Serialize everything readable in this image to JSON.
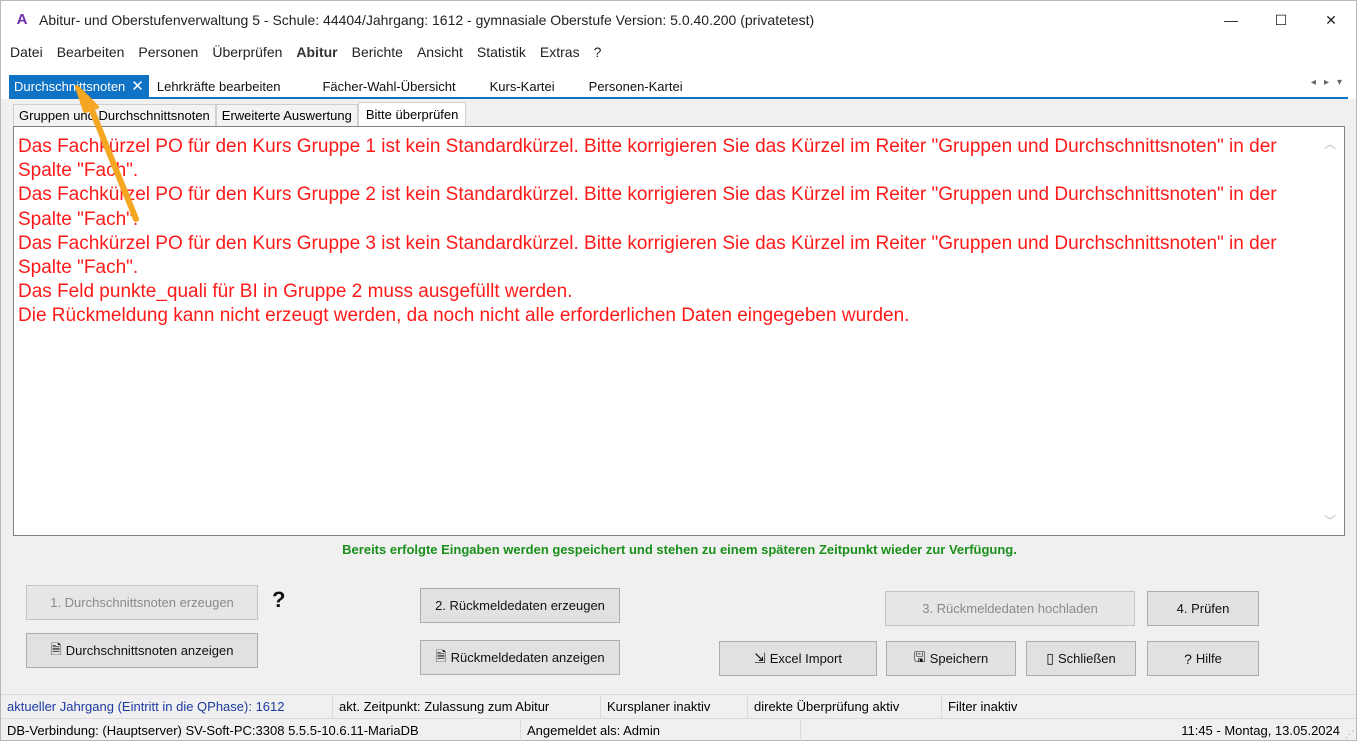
{
  "window": {
    "title": "Abitur- und Oberstufenverwaltung 5 - Schule: 44404/Jahrgang: 1612 - gymnasiale Oberstufe Version: 5.0.40.200 (privatetest)",
    "app_icon": "A",
    "minimize_glyph": "—",
    "maximize_glyph": "☐",
    "close_glyph": "✕"
  },
  "menu": [
    "Datei",
    "Bearbeiten",
    "Personen",
    "Überprüfen",
    "Abitur",
    "Berichte",
    "Ansicht",
    "Statistik",
    "Extras",
    "?"
  ],
  "tabs": [
    {
      "label": "Durchschnittsnoten",
      "active": true
    },
    {
      "label": "Lehrkräfte bearbeiten"
    },
    {
      "label": "Fächer-Wahl-Übersicht"
    },
    {
      "label": "Kurs-Kartei"
    },
    {
      "label": "Personen-Kartei"
    }
  ],
  "tab_close_glyph": "✕",
  "tab_nav": {
    "left": "◂",
    "right": "▸",
    "down": "▾"
  },
  "subtabs": [
    {
      "label": "Gruppen und Durchschnittsnoten"
    },
    {
      "label": "Erweiterte Auswertung"
    },
    {
      "label": "Bitte überprüfen",
      "active": true
    }
  ],
  "messages": [
    "Das Fachkürzel PO für den Kurs Gruppe 1  ist kein Standardkürzel. Bitte korrigieren Sie das Kürzel im Reiter \"Gruppen und Durchschnittsnoten\" in der Spalte \"Fach\".",
    "Das Fachkürzel PO für den Kurs Gruppe 2  ist kein Standardkürzel. Bitte korrigieren Sie das Kürzel im Reiter \"Gruppen und Durchschnittsnoten\" in der Spalte \"Fach\".",
    "Das Fachkürzel PO für den Kurs Gruppe 3  ist kein Standardkürzel. Bitte korrigieren Sie das Kürzel im Reiter \"Gruppen und Durchschnittsnoten\" in der Spalte \"Fach\".",
    "Das Feld punkte_quali für BI in Gruppe 2 muss ausgefüllt werden.",
    "Die Rückmeldung kann nicht erzeugt werden, da noch nicht alle erforderlichen Daten eingegeben wurden."
  ],
  "info_text": "Bereits erfolgte Eingaben werden gespeichert und stehen zu einem späteren Zeitpunkt wieder zur Verfügung.",
  "buttons": {
    "durchschnitt_erzeugen": "1. Durchschnittsnoten erzeugen",
    "durchschnitt_anzeigen": "Durchschnittsnoten anzeigen",
    "rueckmelde_erzeugen": "2. Rückmeldedaten erzeugen",
    "rueckmelde_anzeigen": "Rückmeldedaten anzeigen",
    "hochladen": "3. Rückmeldedaten hochladen",
    "pruefen": "4. Prüfen",
    "excel_import": "Excel Import",
    "speichern": "Speichern",
    "schliessen": "Schließen",
    "hilfe": "Hilfe",
    "help_q": "?"
  },
  "status1": {
    "jahrgang": "aktueller Jahrgang (Eintritt in die QPhase): 1612",
    "zeitpunkt": "akt. Zeitpunkt: Zulassung zum Abitur",
    "kursplaner": "Kursplaner inaktiv",
    "pruefung": "direkte Überprüfung aktiv",
    "filter": "Filter inaktiv"
  },
  "status2": {
    "db": "DB-Verbindung: (Hauptserver) SV-Soft-PC:3308 5.5.5-10.6.11-MariaDB",
    "user": "Angemeldet als: Admin",
    "datetime": "11:45 - Montag, 13.05.2024"
  },
  "colors": {
    "accent": "#0e72c5",
    "error": "#ff1a1a",
    "info": "#1a8f1a",
    "arrow": "#f5a623"
  }
}
